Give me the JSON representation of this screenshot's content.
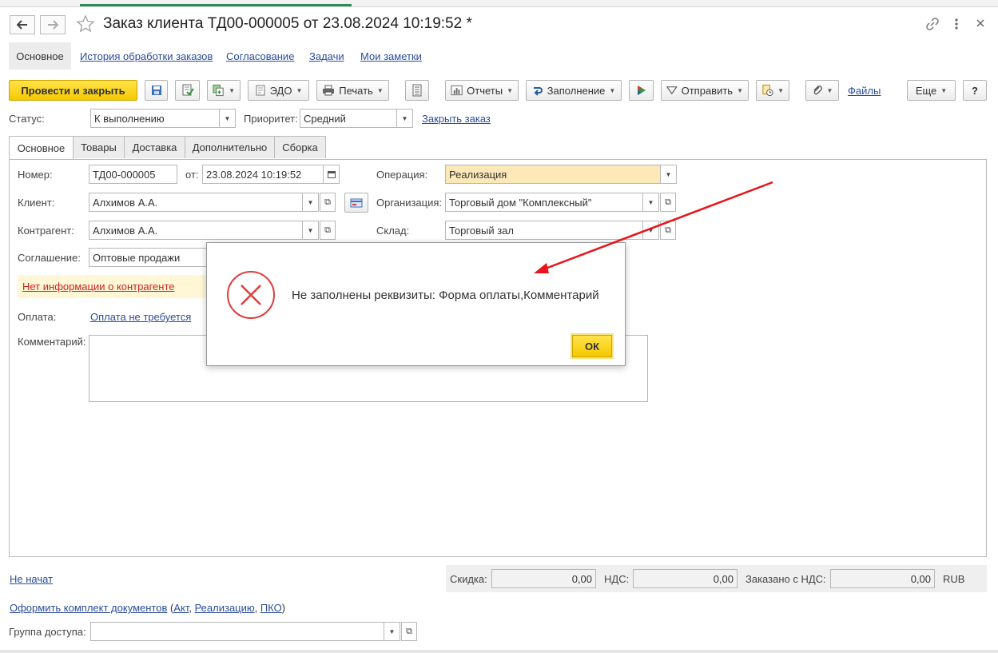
{
  "window": {
    "title": "Заказ клиента ТД00-000005 от 23.08.2024 10:19:52 *",
    "back_icon": "arrow-left-icon",
    "forward_icon": "arrow-right-icon",
    "star_icon": "star-icon",
    "link_icon": "link-icon",
    "more_icon": "more-vertical-icon",
    "close_icon": "close-icon"
  },
  "nav": {
    "items": [
      "Основное",
      "История обработки заказов",
      "Согласование",
      "Задачи",
      "Мои заметки"
    ]
  },
  "toolbar": {
    "post_close": "Провести и закрыть",
    "edo": "ЭДО",
    "print": "Печать",
    "reports": "Отчеты",
    "fill": "Заполнение",
    "send": "Отправить",
    "files": "Файлы",
    "more": "Еще",
    "help": "?"
  },
  "status_row": {
    "status_label": "Статус:",
    "status_value": "К выполнению",
    "priority_label": "Приоритет:",
    "priority_value": "Средний",
    "close_order_link": "Закрыть заказ"
  },
  "tabs": [
    "Основное",
    "Товары",
    "Доставка",
    "Дополнительно",
    "Сборка"
  ],
  "form": {
    "number_label": "Номер:",
    "number_value": "ТД00-000005",
    "date_label": "от:",
    "date_value": "23.08.2024 10:19:52",
    "operation_label": "Операция:",
    "operation_value": "Реализация",
    "client_label": "Клиент:",
    "client_value": "Алхимов А.А.",
    "organization_label": "Организация:",
    "organization_value": "Торговый дом \"Комплексный\"",
    "contractor_label": "Контрагент:",
    "contractor_value": "Алхимов А.А.",
    "warehouse_label": "Склад:",
    "warehouse_value": "Торговый зал",
    "agreement_label": "Соглашение:",
    "agreement_value": "Оптовые продажи",
    "warning_text": "Нет информации о контрагенте",
    "payment_label": "Оплата:",
    "payment_value": "Оплата не требуется",
    "comment_label": "Комментарий:",
    "comment_value": ""
  },
  "footer": {
    "state_link": "Не начат",
    "discount_label": "Скидка:",
    "discount_value": "0,00",
    "vat_label": "НДС:",
    "vat_value": "0,00",
    "ordered_label": "Заказано с НДС:",
    "ordered_value": "0,00",
    "currency": "RUB",
    "docs_prefix": "Оформить комплект документов",
    "docs_open": " (",
    "docs_act": "Акт",
    "docs_sep1": ", ",
    "docs_sale": "Реализацию",
    "docs_sep2": ", ",
    "docs_pko": "ПКО",
    "docs_close": ")",
    "access_group_label": "Группа доступа:",
    "access_group_value": ""
  },
  "dialog": {
    "icon": "error-circle-icon",
    "message": "Не заполнены реквизиты: Форма оплаты,Комментарий",
    "ok_label": "ОК"
  },
  "colors": {
    "accent_yellow": "#f5c800",
    "link": "#2a4c9a",
    "error_red": "#e03c3c",
    "operation_bg": "#fde8b8",
    "warning_bg": "#fff7d6",
    "annotation_arrow": "#e8141b"
  }
}
